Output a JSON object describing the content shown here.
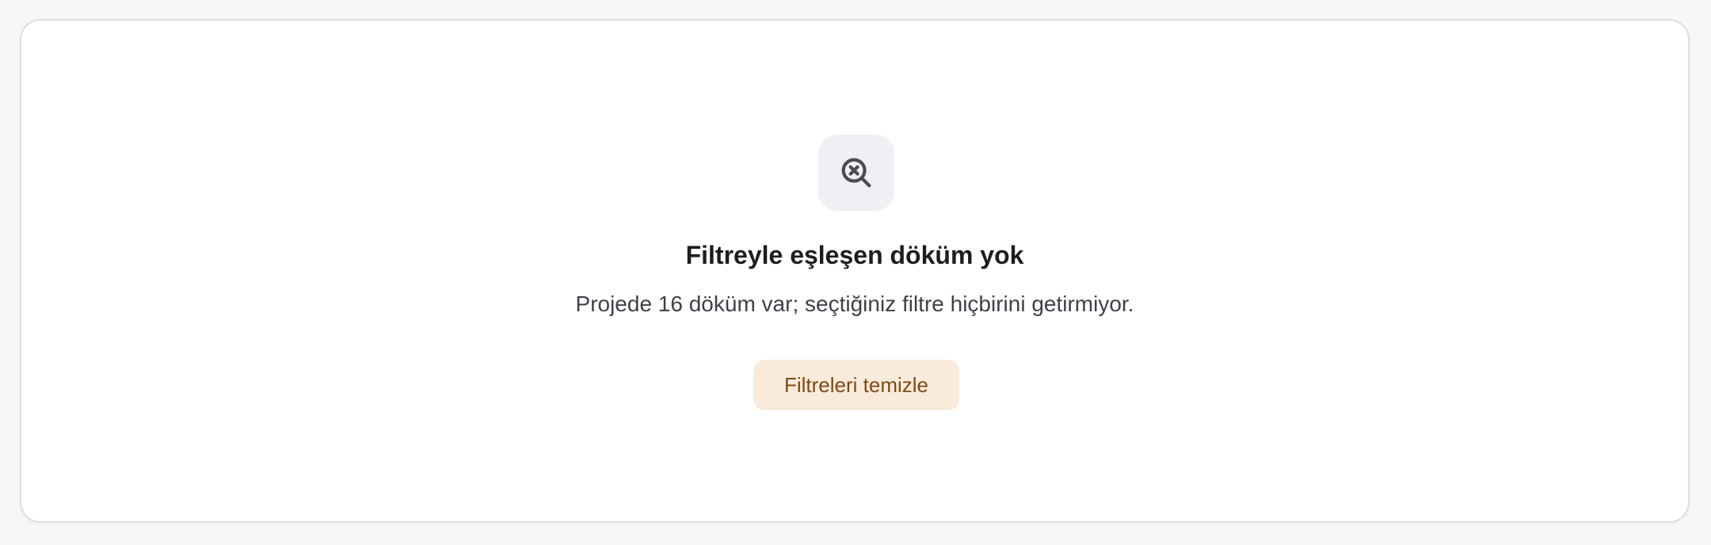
{
  "empty_state": {
    "icon": "search-x-icon",
    "title": "Filtreyle eşleşen döküm yok",
    "description": "Projede 16 döküm var; seçtiğiniz filtre hiçbirini getirmiyor.",
    "clear_button_label": "Filtreleri temizle"
  },
  "colors": {
    "button_bg": "#f9ebdc",
    "button_text": "#7f4a12",
    "icon_bg": "#eff0f3",
    "icon_stroke": "#4a4c52"
  }
}
